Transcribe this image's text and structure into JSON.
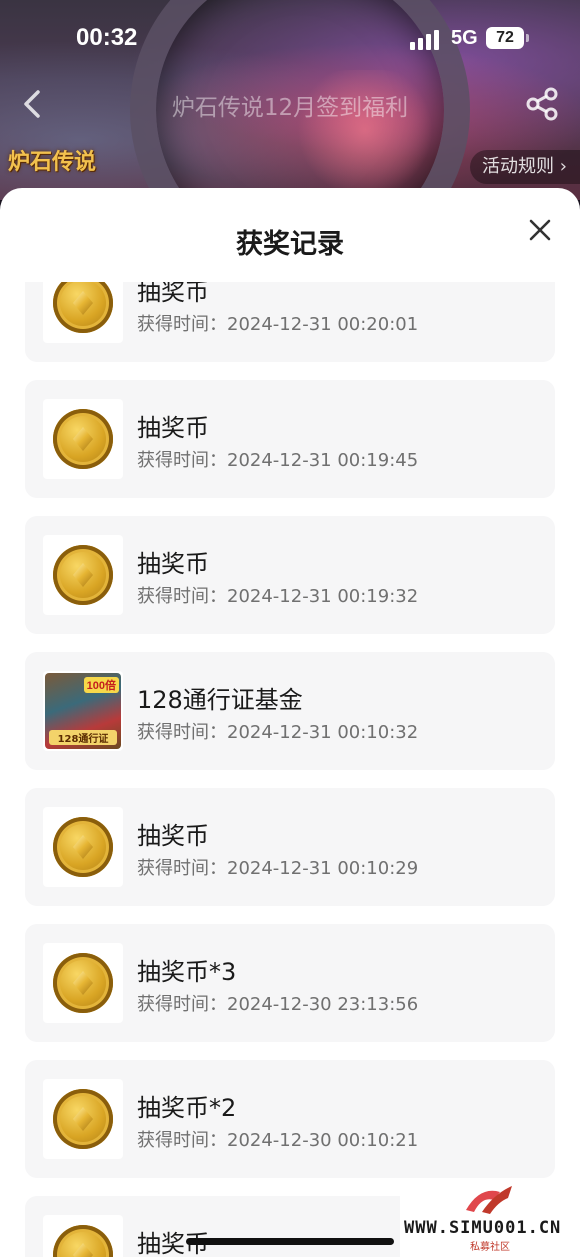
{
  "status_bar": {
    "time": "00:32",
    "network": "5G",
    "battery": "72"
  },
  "header": {
    "title": "炉石传说12月签到福利",
    "logo_text": "炉石传说",
    "rules_label": "活动规则 ›"
  },
  "sheet": {
    "title": "获奖记录"
  },
  "records": [
    {
      "name": "抽奖币",
      "time": "获得时间：2024-12-31 00:20:01",
      "icon": "coin-icon"
    },
    {
      "name": "抽奖币",
      "time": "获得时间：2024-12-31 00:19:45",
      "icon": "coin-icon"
    },
    {
      "name": "抽奖币",
      "time": "获得时间：2024-12-31 00:19:32",
      "icon": "coin-icon"
    },
    {
      "name": "128通行证基金",
      "time": "获得时间：2024-12-31 00:10:32",
      "icon": "battle-pass-icon",
      "badge": "100倍",
      "badge_label": "128通行证"
    },
    {
      "name": "抽奖币",
      "time": "获得时间：2024-12-31 00:10:29",
      "icon": "coin-icon"
    },
    {
      "name": "抽奖币*3",
      "time": "获得时间：2024-12-30 23:13:56",
      "icon": "coin-icon"
    },
    {
      "name": "抽奖币*2",
      "time": "获得时间：2024-12-30 00:10:21",
      "icon": "coin-icon"
    },
    {
      "name": "抽奖币",
      "time": "",
      "icon": "coin-icon"
    }
  ],
  "watermark": {
    "site": "WWW.SIMU001.CN",
    "sub": "私募社区"
  },
  "colors": {
    "sheet_bg": "#ffffff",
    "card_bg": "#f6f6f7",
    "text_primary": "#1a1a1a",
    "text_secondary": "#707070"
  }
}
